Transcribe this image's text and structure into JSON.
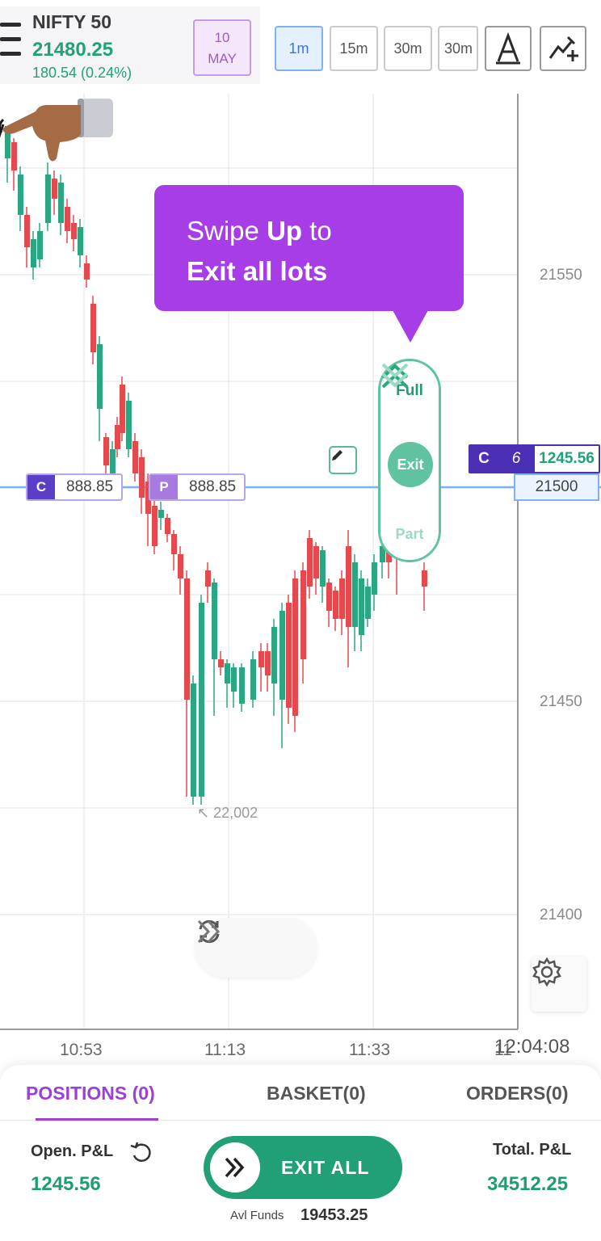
{
  "header": {
    "ticker_name": "NIFTY 50",
    "ticker_price": "21480.25",
    "ticker_change": "180.54 (0.24%)",
    "date_day": "10",
    "date_month": "MAY",
    "timeframes": [
      "1m",
      "15m",
      "30m",
      "30m"
    ],
    "active_timeframe": "1m",
    "tools": [
      "text-tool-icon",
      "draw-line-plus-icon"
    ]
  },
  "chart": {
    "y_labels": [
      "21550",
      "21500",
      "21450",
      "21400"
    ],
    "x_labels": [
      "10:53",
      "11:13",
      "11:33",
      "11"
    ],
    "low_marker": "22,002",
    "current_price": "21500",
    "clock": "12:04:08",
    "call_order": {
      "side": "C",
      "price": "888.85"
    },
    "put_order": {
      "side": "P",
      "price": "888.85"
    },
    "position_tag": {
      "side": "C",
      "qty": "6",
      "pnl": "1245.56"
    },
    "colors": {
      "up": "#2aa683",
      "down": "#e5484d",
      "price_line": "#7fb1f5"
    }
  },
  "swipe_widget": {
    "top_label": "Full",
    "center_label": "Exit",
    "bottom_label": "Part"
  },
  "tooltip": {
    "line1_pre": "Swipe ",
    "line1_bold": "Up",
    "line1_post": " to",
    "line2": "Exit all lots"
  },
  "bottom": {
    "tabs": [
      "POSITIONS (0)",
      "BASKET(0)",
      "ORDERS(0)"
    ],
    "open_pnl_label": "Open. P&L",
    "open_pnl_value": "1245.56",
    "total_pnl_label": "Total. P&L",
    "total_pnl_value": "34512.25",
    "exit_all_label": "EXIT ALL",
    "avl_funds_label": "Avl Funds",
    "avl_funds_value": "19453.25"
  }
}
